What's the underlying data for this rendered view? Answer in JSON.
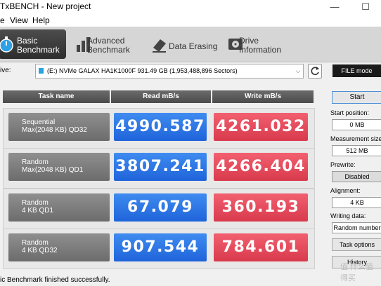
{
  "window": {
    "title": "TxBENCH - New project",
    "minimize_glyph": "—",
    "maximize_glyph": "☐"
  },
  "menu": {
    "items": [
      "e",
      "View",
      "Help"
    ]
  },
  "tabs": [
    {
      "label": "Basic\nBenchmark",
      "icon": "stopwatch-icon",
      "active": true
    },
    {
      "label": "Advanced\nBenchmark",
      "icon": "bar-chart-icon",
      "active": false
    },
    {
      "label": "Data Erasing",
      "icon": "eraser-icon",
      "active": false
    },
    {
      "label": "Drive\nInformation",
      "icon": "drive-info-icon",
      "active": false
    }
  ],
  "drive": {
    "label": "ive:",
    "selected": "(E:) NVMe GALAX HA1K1000F  931.49 GB (1,953,488,896 Sectors)",
    "mode_button": "FILE mode"
  },
  "table": {
    "headers": {
      "task": "Task name",
      "read": "Read mB/s",
      "write": "Write mB/s"
    },
    "rows": [
      {
        "task_line1": "Sequential",
        "task_line2": "Max(2048 KB) QD32",
        "read": "4990.587",
        "write": "4261.032"
      },
      {
        "task_line1": "Random",
        "task_line2": "Max(2048 KB) QD1",
        "read": "3807.241",
        "write": "4266.404"
      },
      {
        "task_line1": "Random",
        "task_line2": "4 KB QD1",
        "read": "67.079",
        "write": "360.193"
      },
      {
        "task_line1": "Random",
        "task_line2": "4 KB QD32",
        "read": "907.544",
        "write": "784.601"
      }
    ]
  },
  "settings": {
    "start_button": "Start",
    "start_position_label": "Start position:",
    "start_position_value": "0 MB",
    "measurement_size_label": "Measurement size:",
    "measurement_size_value": "512 MB",
    "prewrite_label": "Prewrite:",
    "prewrite_value": "Disabled",
    "alignment_label": "Alignment:",
    "alignment_value": "4 KB",
    "writing_data_label": "Writing data:",
    "writing_data_value": "Random number",
    "task_options_button": "Task options",
    "history_button": "History"
  },
  "status": {
    "message": "ic Benchmark finished successfully."
  },
  "watermark": "值 什么值得买",
  "colors": {
    "read": "#2a72e4",
    "write": "#e44a5c",
    "header": "#5a5a5a",
    "task": "#7d7d7d"
  }
}
